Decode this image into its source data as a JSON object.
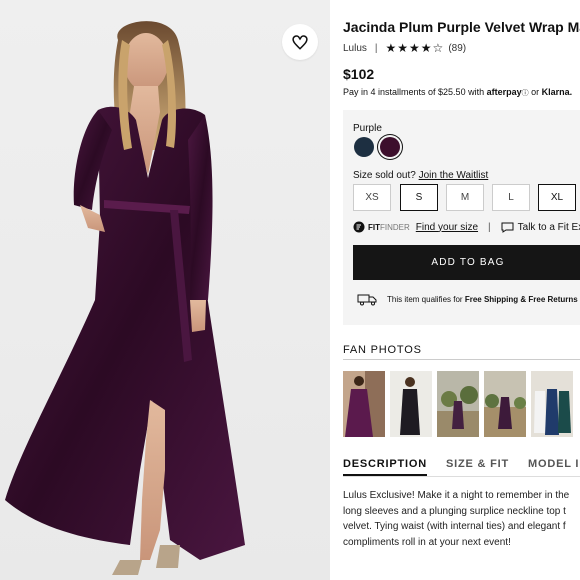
{
  "product": {
    "title": "Jacinda Plum Purple Velvet Wrap Maxi Dress",
    "brand": "Lulus",
    "stars": "★★★★☆",
    "rating": 4,
    "review_count": "(89)",
    "price": "$102",
    "afterpay": {
      "prefix": "Pay in 4 installments of $25.50 with",
      "afterpay_brand": "afterpay",
      "or": "or",
      "klarna_brand": "Klarna."
    }
  },
  "color": {
    "label": "Purple",
    "swatches": [
      {
        "name": "Navy",
        "hex": "#1d2f41"
      },
      {
        "name": "Purple",
        "hex": "#3d0f2c",
        "selected": true
      }
    ]
  },
  "sizes": {
    "soldout_text": "Size sold out?",
    "waitlist_link": "Join the Waitlist",
    "options": [
      {
        "label": "XS",
        "available": false
      },
      {
        "label": "S",
        "available": true
      },
      {
        "label": "M",
        "available": false
      },
      {
        "label": "L",
        "available": false
      },
      {
        "label": "XL",
        "available": true
      }
    ]
  },
  "fit": {
    "fit_label": "FIT",
    "finder_label": "FINDER",
    "find_size": "Find your size",
    "chat": "Talk to a Fit Expert"
  },
  "cart": {
    "add_label": "ADD TO BAG"
  },
  "shipping": {
    "prefix": "This item qualifies for",
    "bold": "Free Shipping & Free Returns"
  },
  "fan_photos": {
    "title": "FAN PHOTOS"
  },
  "tabs": [
    {
      "label": "DESCRIPTION",
      "active": true
    },
    {
      "label": "SIZE & FIT",
      "active": false
    },
    {
      "label": "MODEL INFO",
      "active": false
    }
  ],
  "description": {
    "line1": "Lulus Exclusive! Make it a night to remember in the",
    "line2": "long sleeves and a plunging surplice neckline top t",
    "line3": "velvet. Tying waist (with internal ties) and elegant f",
    "line4": "compliments roll in at your next event!"
  },
  "icons": {
    "wishlist": "heart-icon",
    "ruler": "fit-finder-icon",
    "chat": "chat-icon",
    "truck": "truck-icon"
  },
  "colors": {
    "dress": "#3a0e2e",
    "button": "#151515",
    "panel": "#f4f4f4"
  }
}
